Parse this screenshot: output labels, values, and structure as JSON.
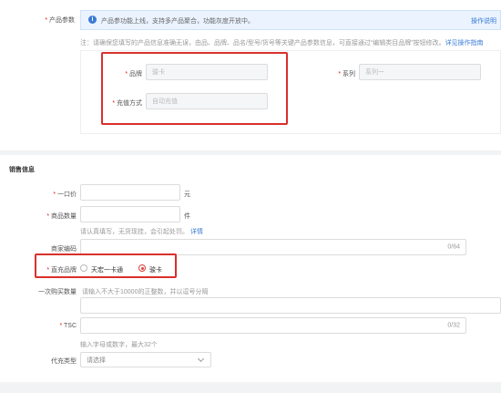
{
  "product_params": {
    "label": "产品参数",
    "info_banner": {
      "text": "产品参功能上线，支持多产品聚合，功能灰度开放中。",
      "action": "操作说明"
    },
    "note_prefix": "注：",
    "note_text": "请确保您填写的产品信息准确无误，由品、品牌、品名/型号/货号等关键产品参数信息，可直接通过“编辑类目品牌”按钮修改。",
    "note_link": "详见操作指南",
    "brand": {
      "label": "品牌",
      "value": "骏卡"
    },
    "series": {
      "label": "系列",
      "placeholder": "系列一"
    },
    "recharge": {
      "label": "充值方式",
      "placeholder": "自动充值"
    }
  },
  "sales": {
    "section_title": "销售信息",
    "price": {
      "label": "一口价",
      "unit": "元"
    },
    "quantity": {
      "label": "商品数量",
      "unit": "件",
      "hint": "请认真填写，无货现挂，会引起处罚。",
      "hint_link": "详情"
    },
    "merchant_code": {
      "label": "商家编码",
      "counter": "0/64"
    },
    "recharge_brand": {
      "label": "直充品牌",
      "options": [
        {
          "label": "天宏一卡通",
          "selected": false
        },
        {
          "label": "骏卡",
          "selected": true
        }
      ]
    },
    "purchase_qty": {
      "label": "一次购买数量",
      "placeholder": "请输入不大于10000的正整数，并以逗号分隔"
    },
    "tsc": {
      "label": "TSC",
      "counter": "0/32",
      "hint": "输入字母或数字，最大32个"
    },
    "recharge_type": {
      "label": "代充类型",
      "placeholder": "请选择"
    }
  }
}
